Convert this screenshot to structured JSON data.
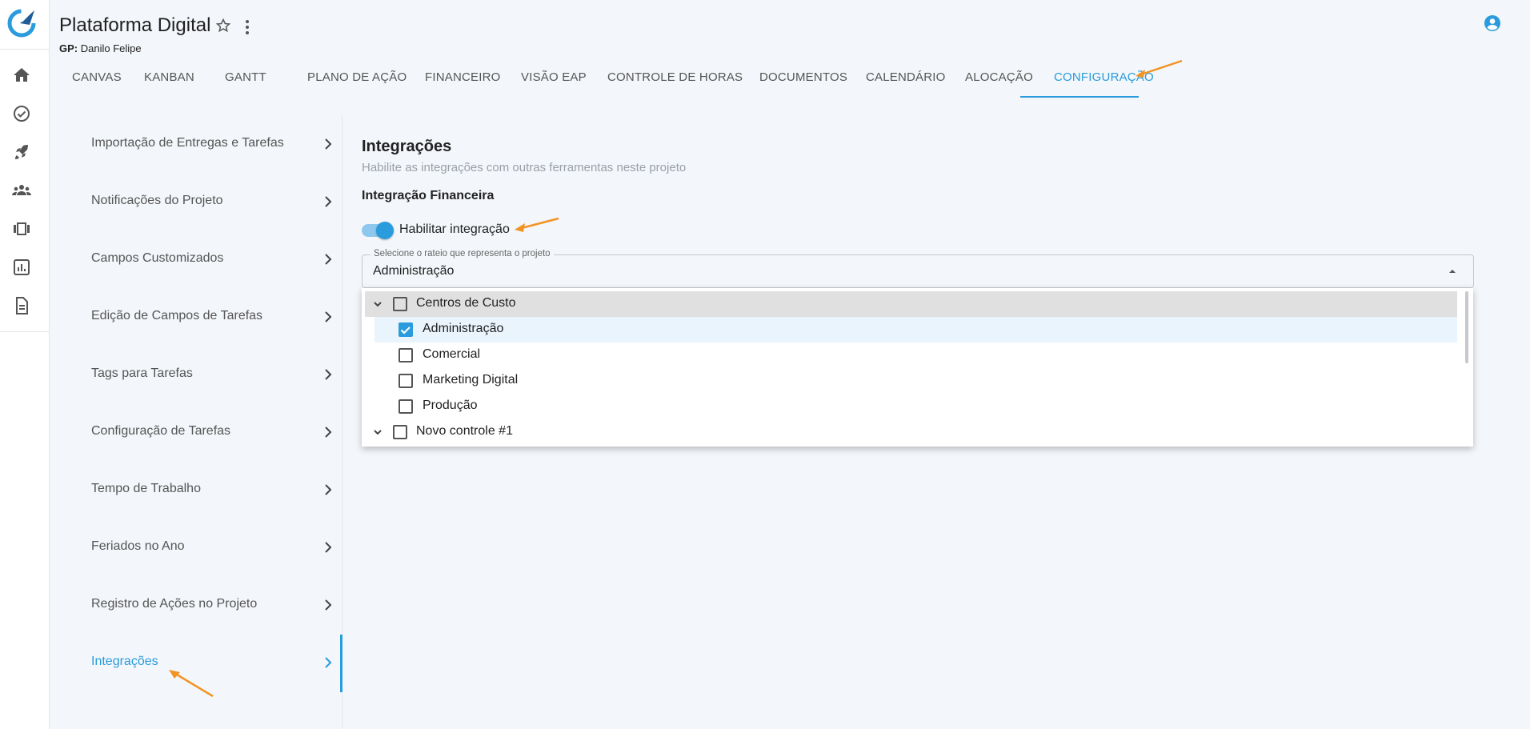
{
  "colors": {
    "accent": "#2a9bdc",
    "annotation": "#f29322",
    "background": "#f3f6fa"
  },
  "rail": {
    "icons": [
      "rocket-logo-icon",
      "home-icon",
      "check-circle-icon",
      "rocket-icon",
      "people-icon",
      "carousel-icon",
      "chart-icon",
      "document-icon"
    ]
  },
  "header": {
    "title": "Plataforma Digital",
    "gp_label": "GP:",
    "gp_name": "Danilo Felipe"
  },
  "tabs": [
    "CANVAS",
    "KANBAN",
    "GANTT",
    "PLANO DE AÇÃO",
    "FINANCEIRO",
    "VISÃO EAP",
    "CONTROLE DE HORAS",
    "DOCUMENTOS",
    "CALENDÁRIO",
    "ALOCAÇÃO",
    "CONFIGURAÇÃO"
  ],
  "active_tab": "CONFIGURAÇÃO",
  "settings_menu": [
    "Importação de Entregas e Tarefas",
    "Notificações do Projeto",
    "Campos Customizados",
    "Edição de Campos de Tarefas",
    "Tags para Tarefas",
    "Configuração de Tarefas",
    "Tempo de Trabalho",
    "Feriados no Ano",
    "Registro de Ações no Projeto",
    "Integrações"
  ],
  "active_setting": "Integrações",
  "integrations": {
    "title": "Integrações",
    "subtitle": "Habilite as integrações com outras ferramentas neste projeto",
    "financial_title": "Integração Financeira",
    "toggle_label": "Habilitar integração",
    "toggle_on": true,
    "select_legend": "Selecione o rateio que representa o projeto",
    "select_value": "Administração"
  },
  "dropdown": {
    "groups": [
      {
        "label": "Centros de Custo",
        "checked": false,
        "expanded": true,
        "children": [
          {
            "label": "Administração",
            "checked": true
          },
          {
            "label": "Comercial",
            "checked": false
          },
          {
            "label": "Marketing Digital",
            "checked": false
          },
          {
            "label": "Produção",
            "checked": false
          }
        ]
      },
      {
        "label": "Novo controle #1",
        "checked": false,
        "expanded": true,
        "children": []
      }
    ]
  }
}
